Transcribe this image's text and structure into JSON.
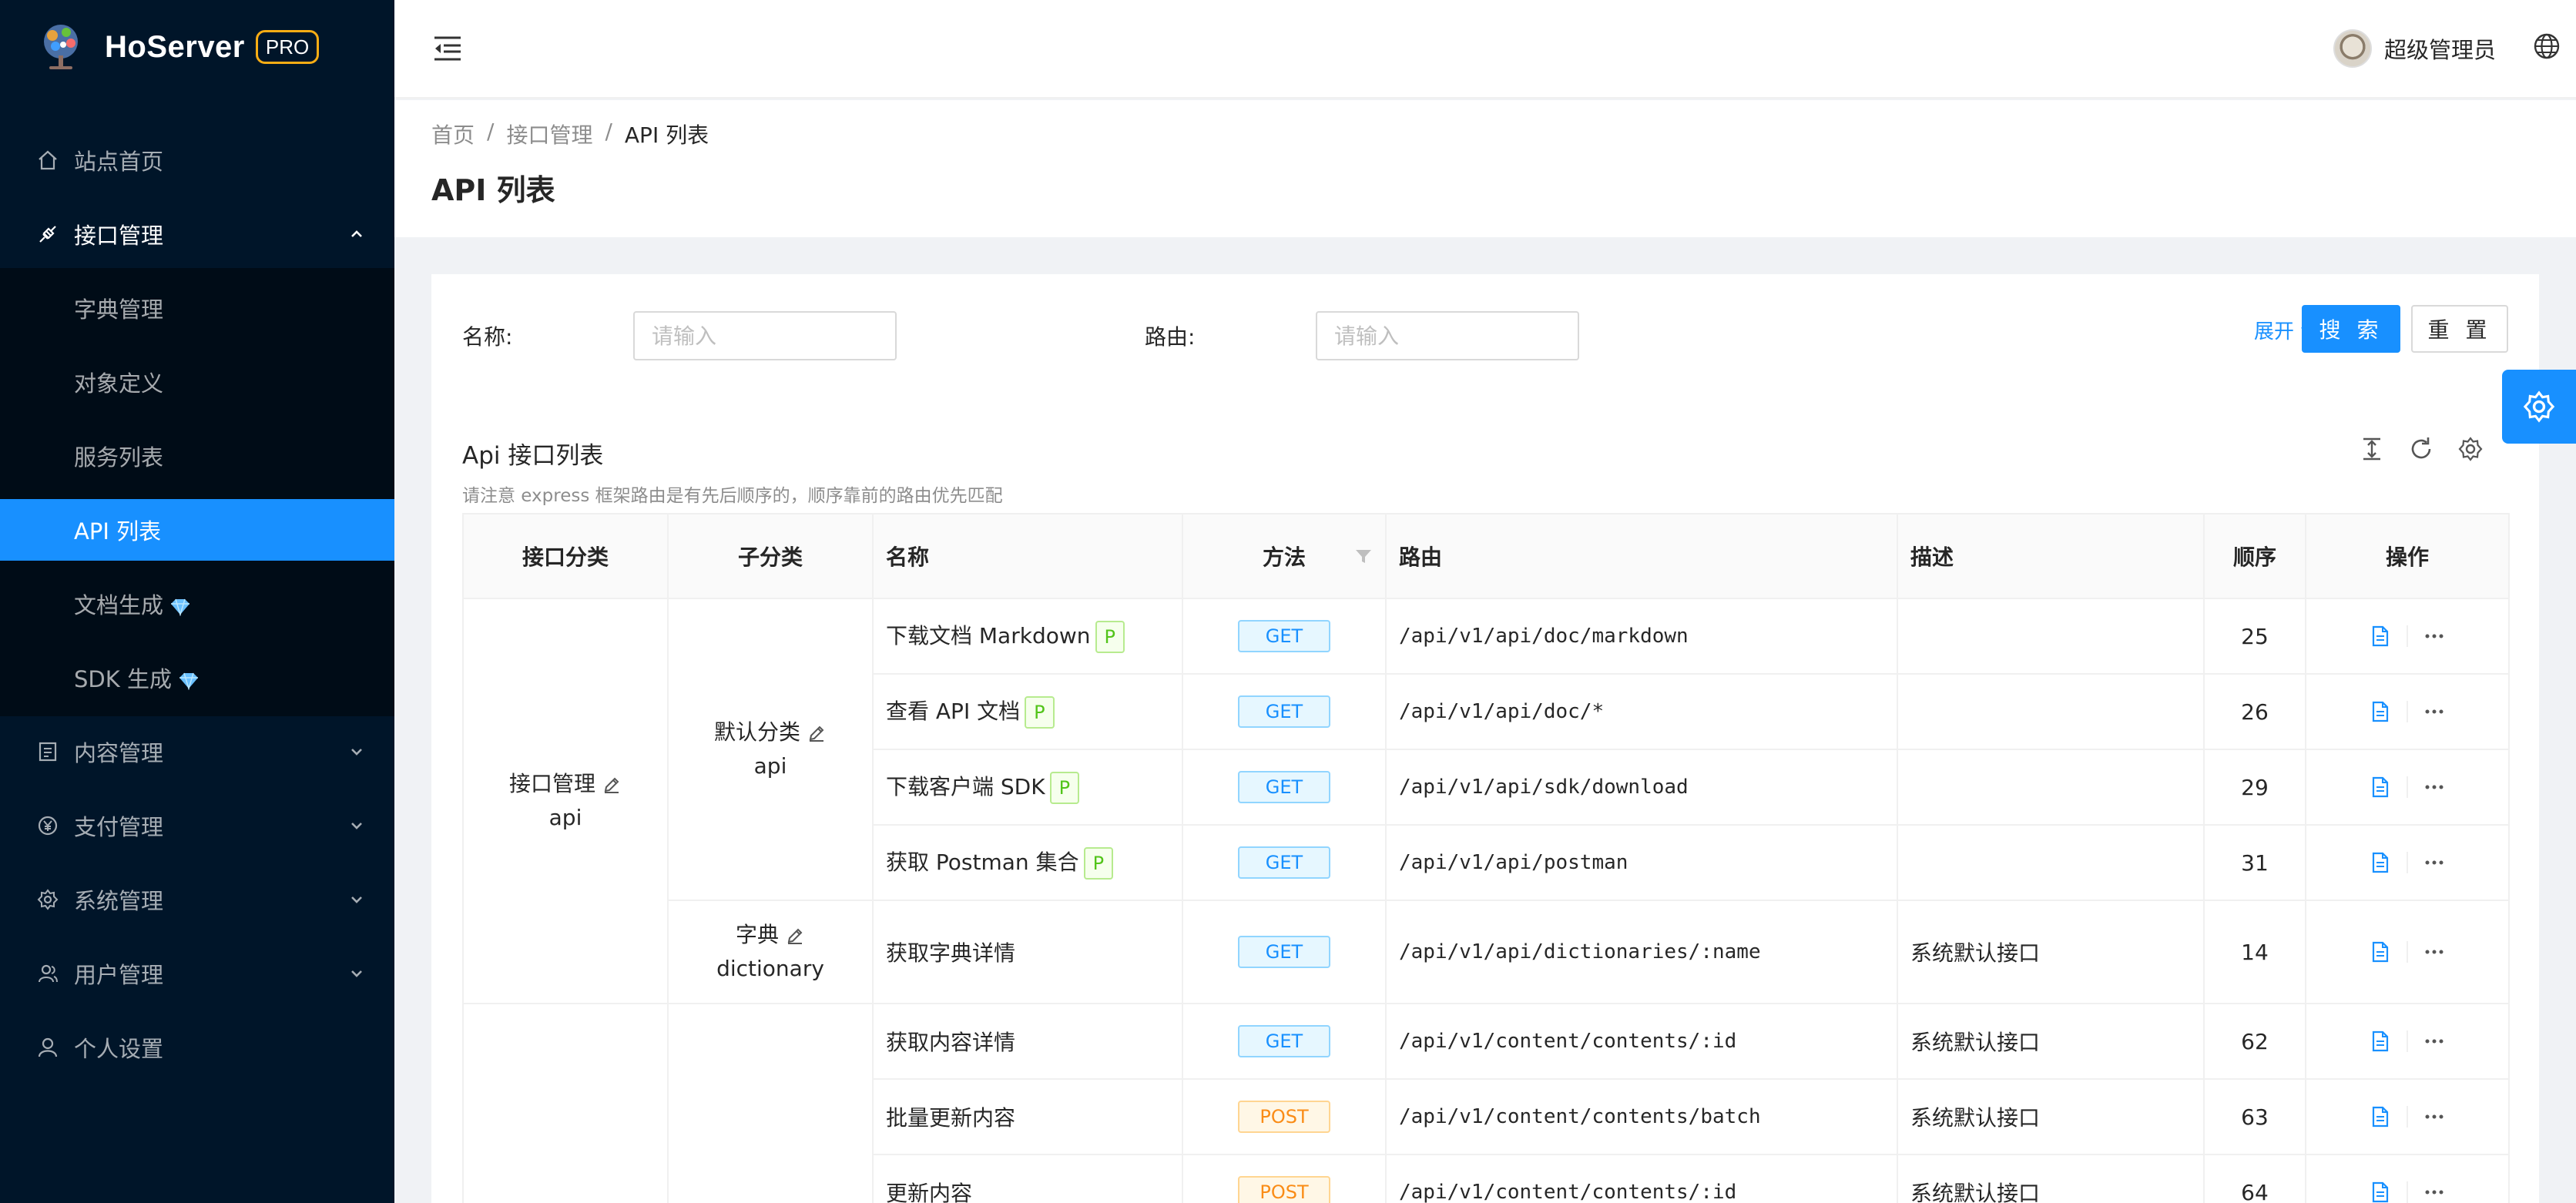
{
  "brand": {
    "name": "HoServer",
    "badge": "PRO"
  },
  "sidebar": {
    "items": [
      {
        "label": "站点首页",
        "icon": "home-icon"
      },
      {
        "label": "接口管理",
        "icon": "api-icon",
        "open": true
      },
      {
        "label": "字典管理"
      },
      {
        "label": "对象定义"
      },
      {
        "label": "服务列表"
      },
      {
        "label": "API 列表",
        "selected": true
      },
      {
        "label": "文档生成",
        "icon": "diamond-icon"
      },
      {
        "label": "SDK 生成",
        "icon": "diamond-icon"
      },
      {
        "label": "内容管理",
        "icon": "profile-icon"
      },
      {
        "label": "支付管理",
        "icon": "yuan-icon"
      },
      {
        "label": "系统管理",
        "icon": "setting-icon"
      },
      {
        "label": "用户管理",
        "icon": "team-icon"
      },
      {
        "label": "个人设置",
        "icon": "user-icon"
      }
    ]
  },
  "header": {
    "user_name": "超级管理员"
  },
  "breadcrumb": {
    "items": [
      "首页",
      "接口管理",
      "API 列表"
    ]
  },
  "page_title": "API 列表",
  "search": {
    "name_label": "名称:",
    "name_placeholder": "请输入",
    "route_label": "路由:",
    "route_placeholder": "请输入",
    "expand_label": "展开",
    "search_button": "搜 索",
    "reset_button": "重 置"
  },
  "list": {
    "title": "Api 接口列表",
    "subtitle": "请注意 express 框架路由是有先后顺序的，顺序靠前的路由优先匹配"
  },
  "table": {
    "columns": [
      "接口分类",
      "子分类",
      "名称",
      "方法",
      "路由",
      "描述",
      "顺序",
      "操作"
    ],
    "groups": [
      {
        "category": "接口管理",
        "category_key": "api",
        "subgroups": [
          {
            "name": "默认分类",
            "key": "api",
            "rows": [
              {
                "name": "下载文档 Markdown",
                "p": "P",
                "method": "GET",
                "route": "/api/v1/api/doc/markdown",
                "desc": "",
                "order": "25"
              },
              {
                "name": "查看 API 文档",
                "p": "P",
                "method": "GET",
                "route": "/api/v1/api/doc/*",
                "desc": "",
                "order": "26"
              },
              {
                "name": "下载客户端 SDK",
                "p": "P",
                "method": "GET",
                "route": "/api/v1/api/sdk/download",
                "desc": "",
                "order": "29"
              },
              {
                "name": "获取 Postman 集合",
                "p": "P",
                "method": "GET",
                "route": "/api/v1/api/postman",
                "desc": "",
                "order": "31"
              }
            ]
          },
          {
            "name": "字典",
            "key": "dictionary",
            "rows": [
              {
                "name": "获取字典详情",
                "method": "GET",
                "route": "/api/v1/api/dictionaries/:name",
                "desc": "系统默认接口",
                "order": "14"
              }
            ]
          }
        ]
      },
      {
        "category": "",
        "category_key": "",
        "subgroups": [
          {
            "name": "",
            "key": "",
            "rows": [
              {
                "name": "获取内容详情",
                "method": "GET",
                "route": "/api/v1/content/contents/:id",
                "desc": "系统默认接口",
                "order": "62"
              },
              {
                "name": "批量更新内容",
                "method": "POST",
                "route": "/api/v1/content/contents/batch",
                "desc": "系统默认接口",
                "order": "63"
              },
              {
                "name": "更新内容",
                "method": "POST",
                "route": "/api/v1/content/contents/:id",
                "desc": "系统默认接口",
                "order": "64"
              }
            ]
          }
        ]
      }
    ]
  },
  "colors": {
    "primary": "#1890ff",
    "sider": "#001529",
    "submenu": "#000c17",
    "badge": "#faad14"
  }
}
